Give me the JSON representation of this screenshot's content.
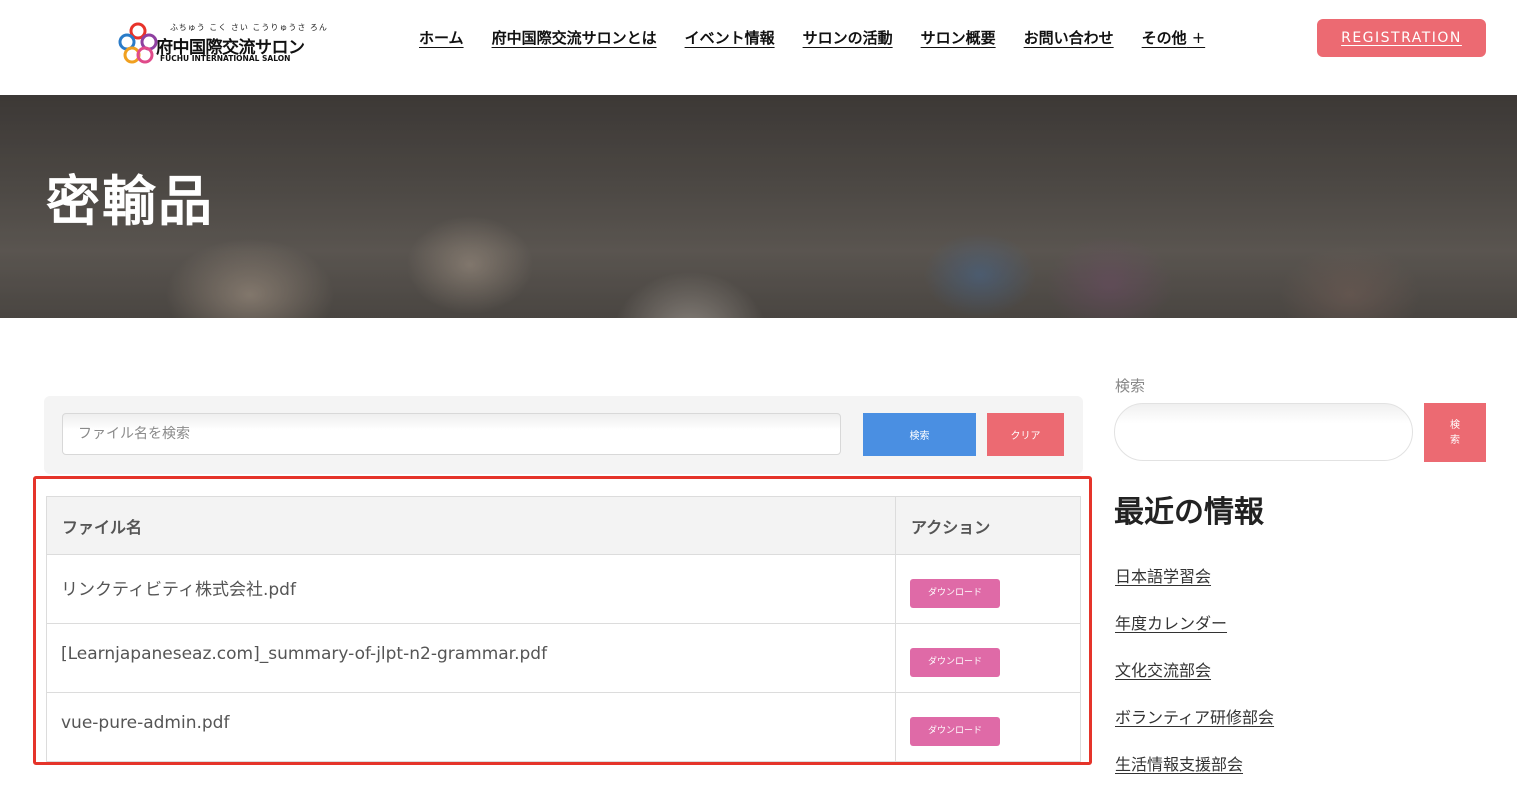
{
  "header": {
    "logo": {
      "ruby": "ふちゅう こく さい こうりゅうさ ろん",
      "name_jp": "府中国際交流サロン",
      "name_en": "FUCHU INTERNATIONAL SALON"
    },
    "nav": [
      "ホーム",
      "府中国際交流サロンとは",
      "イベント情報",
      "サロンの活動",
      "サロン概要",
      "お問い合わせ",
      "その他"
    ],
    "registration": "REGISTRATION"
  },
  "hero": {
    "title": "密輸品"
  },
  "file_search": {
    "placeholder": "ファイル名を検索",
    "search_label": "検索",
    "clear_label": "クリア"
  },
  "table": {
    "headers": [
      "ファイル名",
      "アクション"
    ],
    "rows": [
      {
        "name": "リンクティビティ株式会社.pdf",
        "action": "ダウンロード"
      },
      {
        "name": "[Learnjapaneseaz.com]_summary-of-jlpt-n2-grammar.pdf",
        "action": "ダウンロード"
      },
      {
        "name": "vue-pure-admin.pdf",
        "action": "ダウンロード"
      }
    ]
  },
  "sidebar": {
    "search_label": "検索",
    "search_button": "検索",
    "recent_title": "最近の情報",
    "recent_items": [
      "日本語学習会",
      "年度カレンダー",
      "文化交流部会",
      "ボランティア研修部会",
      "生活情報支援部会"
    ]
  },
  "colors": {
    "accent_pink": "#ec6a72",
    "search_blue": "#4a8fe2",
    "download_pink": "#df6aa7",
    "highlight_red": "#e5342a"
  }
}
